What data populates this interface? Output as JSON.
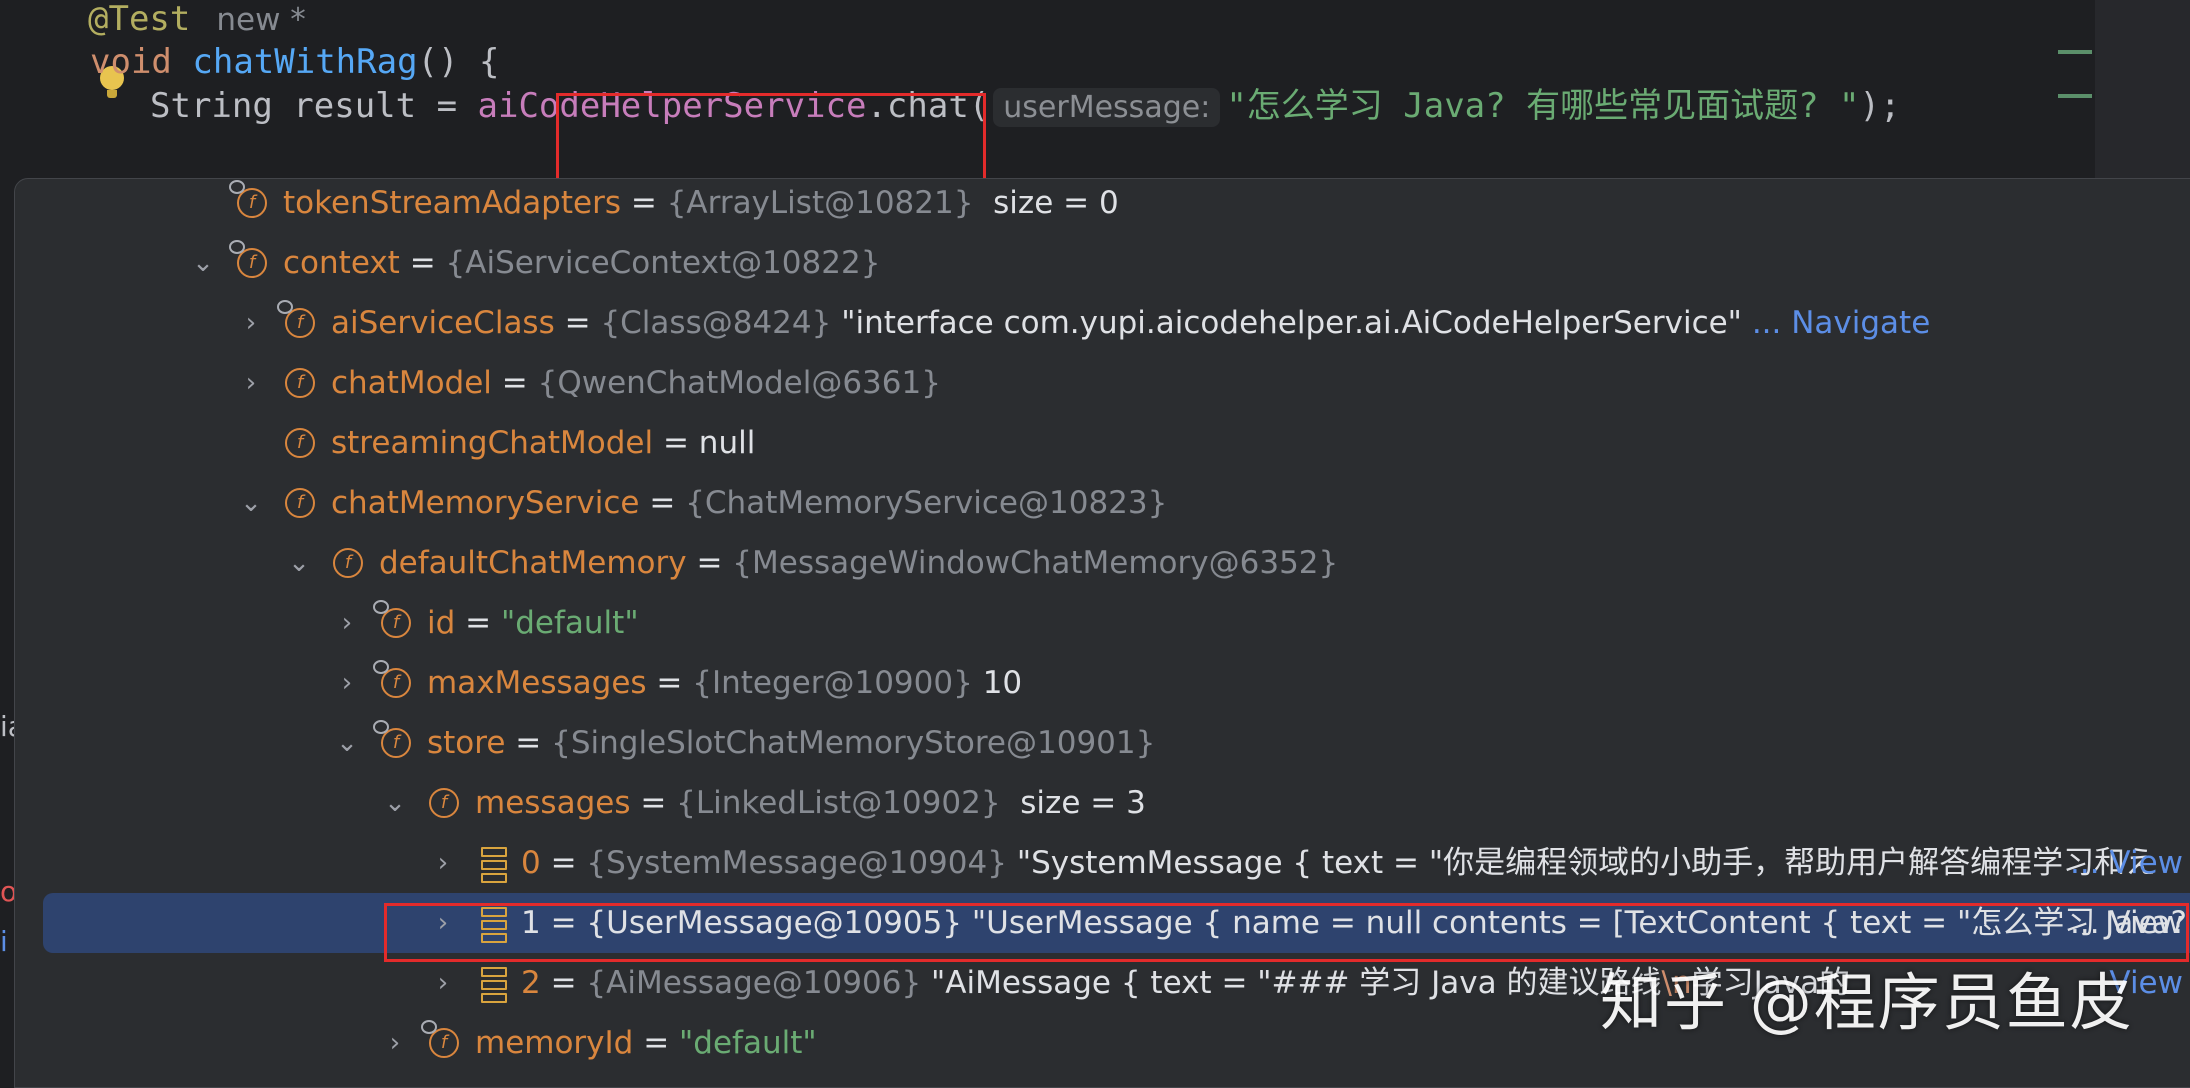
{
  "editor": {
    "line1": {
      "annotation": "@Test",
      "hint": "new *"
    },
    "line2": {
      "keyword": "void",
      "method": "chatWithRag",
      "rest": "() {"
    },
    "line3": {
      "prefix": "String result = ",
      "service": "aiCodeHelperService",
      "call": ".chat(",
      "param_hint": "userMessage:",
      "argument": "\"怎么学习 Java? 有哪些常见面试题? \"",
      "suffix": ");"
    }
  },
  "debug_tree": {
    "rows": [
      {
        "name": "tokenStreamAdapters",
        "type": "{ArrayList@10821}",
        "value": "size = 0"
      },
      {
        "name": "context",
        "type": "{AiServiceContext@10822}"
      },
      {
        "name": "aiServiceClass",
        "type": "{Class@8424}",
        "value": "\"interface com.yupi.aicodehelper.ai.AiCodeHelperService\"",
        "link": "... Navigate"
      },
      {
        "name": "chatModel",
        "type": "{QwenChatModel@6361}"
      },
      {
        "name": "streamingChatModel",
        "value": "null"
      },
      {
        "name": "chatMemoryService",
        "type": "{ChatMemoryService@10823}"
      },
      {
        "name": "defaultChatMemory",
        "type": "{MessageWindowChatMemory@6352}"
      },
      {
        "name": "id",
        "value": "\"default\""
      },
      {
        "name": "maxMessages",
        "type": "{Integer@10900}",
        "value": "10"
      },
      {
        "name": "store",
        "type": "{SingleSlotChatMemoryStore@10901}"
      },
      {
        "name": "messages",
        "type": "{LinkedList@10902}",
        "value": "size = 3"
      },
      {
        "name": "0",
        "type": "{SystemMessage@10904}",
        "value": "\"SystemMessage { text = \"你是编程领域的小助手，帮助用户解答编程学习和え",
        "link": "... View"
      },
      {
        "name": "1",
        "type": "{UserMessage@10905}",
        "value": "\"UserMessage { name = null contents = [TextContent { text = \"怎么学习 Java? 有",
        "link": "... View"
      },
      {
        "name": "2",
        "type": "{AiMessage@10906}",
        "value": "\"AiMessage { text = \"### 学习 Java 的建议路线",
        "value_nl": "\\n",
        "value_tail": "学习Java的",
        "link": "View"
      },
      {
        "name": "memoryId",
        "value": "\"default\""
      }
    ]
  },
  "edge_glyphs": [
    "ia",
    "o",
    "i"
  ],
  "watermark": "知乎 @程序员鱼皮",
  "colors": {
    "accent_red": "#e32b2b",
    "field_orange": "#d9863e",
    "string_green": "#6aab73",
    "selection": "#2e436e"
  }
}
